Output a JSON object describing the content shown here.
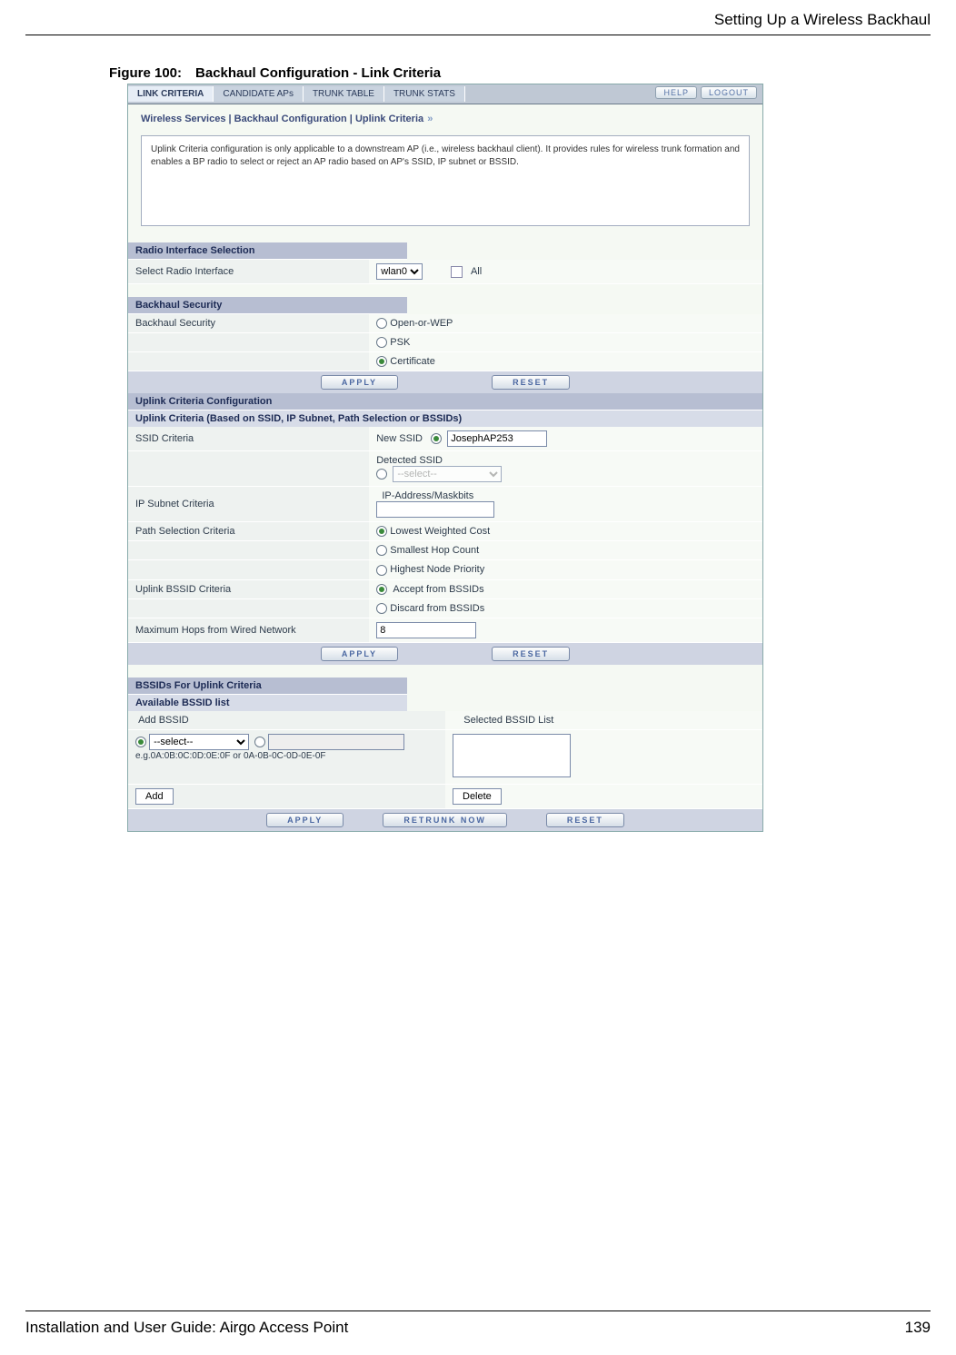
{
  "page": {
    "header_right": "Setting Up a Wireless Backhaul",
    "figure_caption": "Figure 100: Backhaul Configuration - Link Criteria",
    "footer_left": "Installation and User Guide: Airgo Access Point",
    "footer_right": "139"
  },
  "tabs": {
    "items": [
      "LINK CRITERIA",
      "CANDIDATE APs",
      "TRUNK TABLE",
      "TRUNK STATS"
    ],
    "help": "HELP",
    "logout": "LOGOUT"
  },
  "breadcrumb": {
    "a": "Wireless Services",
    "b": "Backhaul Configuration",
    "c": "Uplink Criteria"
  },
  "info": "Uplink Criteria configuration is only applicable to a downstream AP (i.e., wireless backhaul client). It provides rules for wireless trunk formation and enables a BP radio to select or reject an AP radio based on AP's SSID, IP subnet or BSSID.",
  "radio_section": {
    "title": "Radio Interface Selection",
    "label": "Select Radio Interface",
    "select_value": "wlan0",
    "all_label": "All"
  },
  "security": {
    "title": "Backhaul Security",
    "label": "Backhaul Security",
    "options": [
      "Open-or-WEP",
      "PSK",
      "Certificate"
    ],
    "selected": "Certificate"
  },
  "buttons": {
    "apply": "APPLY",
    "reset": "RESET",
    "retrunk": "RETRUNK NOW",
    "add": "Add",
    "delete": "Delete"
  },
  "uplink": {
    "title": "Uplink Criteria Configuration",
    "subtitle": "Uplink Criteria (Based on SSID, IP Subnet, Path Selection or BSSIDs)",
    "ssid_label": "SSID Criteria",
    "new_ssid_label": "New SSID",
    "new_ssid_value": "JosephAP253",
    "detected_ssid_label": "Detected SSID",
    "detected_ssid_value": "--select--",
    "ipsubnet_label": "IP Subnet Criteria",
    "ip_header": "IP-Address/Maskbits",
    "ip_value": "",
    "path_label": "Path Selection Criteria",
    "path_options": [
      "Lowest Weighted Cost",
      "Smallest Hop Count",
      "Highest Node Priority"
    ],
    "path_selected": "Lowest Weighted Cost",
    "bssid_label": "Uplink BSSID Criteria",
    "bssid_options": [
      "Accept from BSSIDs",
      "Discard from BSSIDs"
    ],
    "bssid_selected": "Accept from BSSIDs",
    "maxhops_label": "Maximum Hops from Wired Network",
    "maxhops_value": "8"
  },
  "bssid_section": {
    "title": "BSSIDs For Uplink Criteria",
    "avail_label": "Available BSSID list",
    "add_bssid_label": "Add BSSID",
    "selected_list_label": "Selected BSSID List",
    "select_placeholder": "--select--",
    "example": "e.g.0A:0B:0C:0D:0E:0F or 0A-0B-0C-0D-0E-0F"
  }
}
